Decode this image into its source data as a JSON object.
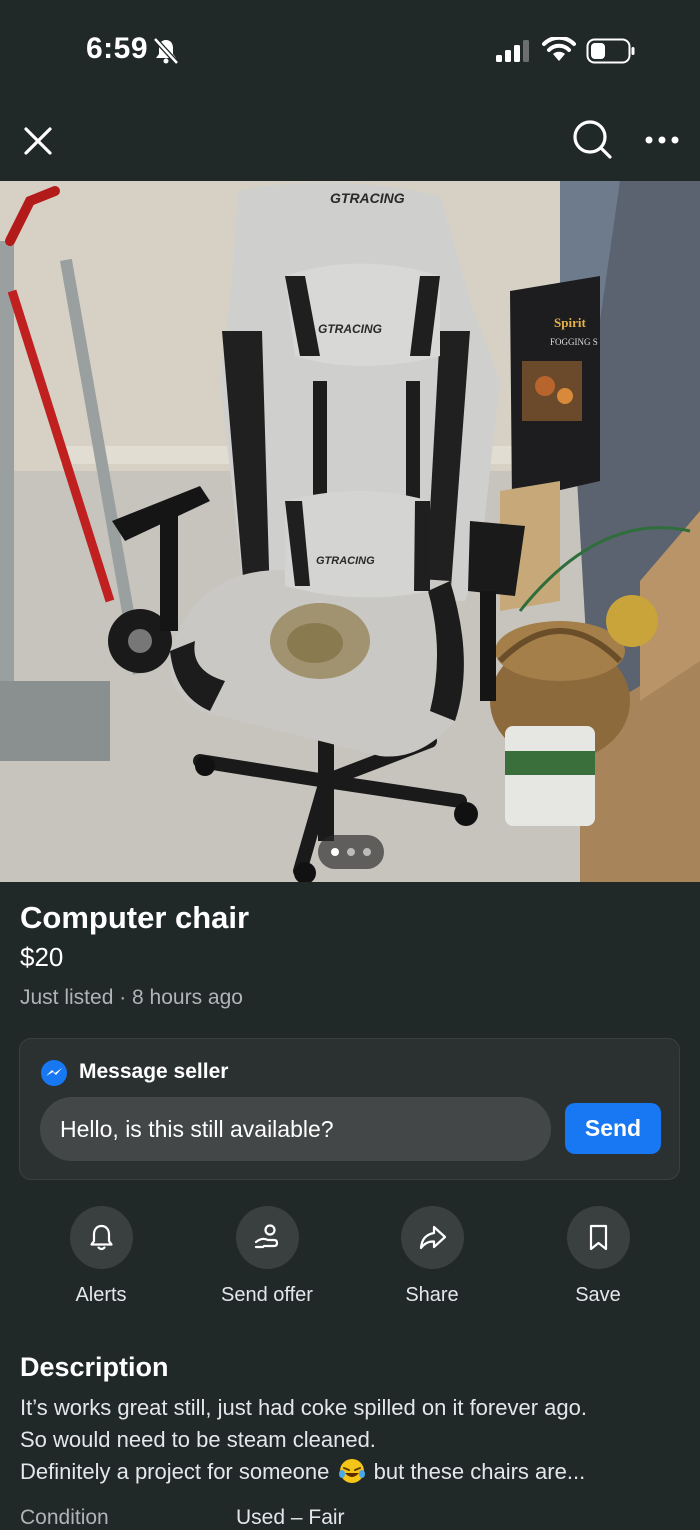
{
  "status_bar": {
    "time": "6:59"
  },
  "listing": {
    "title": "Computer chair",
    "price": "$20",
    "meta": "Just listed · 8 hours ago"
  },
  "photo_text": {
    "brand_top": "GTRACING",
    "brand_pillow": "GTRACING",
    "brand_lumbar": "GTRACING",
    "box_brand": "Spirit",
    "box_subtitle": "FOGGING S"
  },
  "message": {
    "label": "Message seller",
    "input_value": "Hello, is this still available?",
    "send_label": "Send"
  },
  "actions": [
    {
      "label": "Alerts",
      "icon": "bell-icon"
    },
    {
      "label": "Send offer",
      "icon": "offer-icon"
    },
    {
      "label": "Share",
      "icon": "share-icon"
    },
    {
      "label": "Save",
      "icon": "bookmark-icon"
    }
  ],
  "description": {
    "title": "Description",
    "line1": "It’s works great still, just had coke spilled on it forever ago.",
    "line2": "So would need to be steam cleaned.",
    "line3a": "Definitely a project for someone",
    "line3b": "but these chairs are..."
  },
  "details": {
    "condition_label": "Condition",
    "condition_value": "Used – Fair"
  },
  "colors": {
    "accent": "#1877f2",
    "background": "#212828"
  }
}
